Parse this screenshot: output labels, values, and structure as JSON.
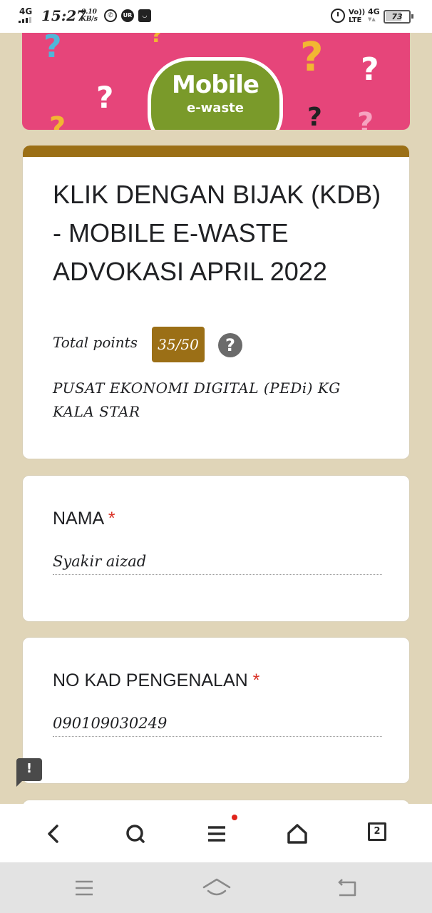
{
  "status_bar": {
    "network": "4G",
    "time": "15:27",
    "speed_value": "0.10",
    "speed_unit": "KB/s",
    "volte_top": "Vo))",
    "volte_bottom": "LTE",
    "network_right": "4G",
    "battery_level": 73,
    "battery_text": "73"
  },
  "banner": {
    "logo_title": "Mobile",
    "logo_subtitle": "e-waste",
    "colors": {
      "background": "#e6457a",
      "logo": "#7a9a2a"
    }
  },
  "form": {
    "title": "KLIK DENGAN BIJAK (KDB) - MOBILE E-WASTE ADVOKASI APRIL 2022",
    "points_label": "Total points",
    "points_value": "35/50",
    "help_icon": "?",
    "description": "PUSAT EKONOMI DIGITAL (PEDi) KG KALA STAR",
    "accent_color": "#9b6f16"
  },
  "questions": [
    {
      "label": "NAMA",
      "required": "*",
      "answer": "Syakir aizad"
    },
    {
      "label": "NO KAD PENGENALAN",
      "required": "*",
      "answer": "090109030249"
    }
  ],
  "feedback": {
    "icon": "!"
  },
  "browser_toolbar": {
    "back_icon": "back-icon",
    "search_icon": "search-icon",
    "menu_icon": "menu-icon",
    "home_icon": "home-icon",
    "tabs_count": "2"
  },
  "nav_bar": {
    "items": [
      "menu",
      "home",
      "back"
    ]
  }
}
